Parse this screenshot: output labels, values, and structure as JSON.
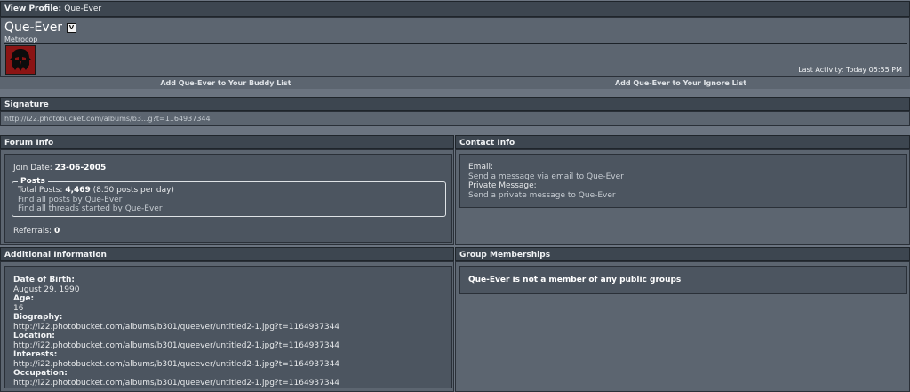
{
  "header": {
    "prefix": "View Profile:",
    "username": "Que-Ever"
  },
  "profile": {
    "display_name": "Que-Ever",
    "rank_badge": "V",
    "title": "Metrocop",
    "last_activity_label": "Last Activity:",
    "last_activity_value": "Today 05:55 PM"
  },
  "actions": {
    "buddy": "Add Que-Ever to Your Buddy List",
    "ignore": "Add Que-Ever to Your Ignore List"
  },
  "signature": {
    "heading": "Signature",
    "text": "http://i22.photobucket.com/albums/b3...g?t=1164937344"
  },
  "forum_info": {
    "heading": "Forum Info",
    "join_label": "Join Date:",
    "join_value": "23-06-2005",
    "posts_legend": "Posts",
    "total_label": "Total Posts:",
    "total_value": "4,469",
    "per_day": "(8.50 posts per day)",
    "find_posts": "Find all posts by Que-Ever",
    "find_threads": "Find all threads started by Que-Ever",
    "referrals_label": "Referrals:",
    "referrals_value": "0"
  },
  "contact_info": {
    "heading": "Contact Info",
    "email_label": "Email:",
    "email_link": "Send a message via email to Que-Ever",
    "pm_label": "Private Message:",
    "pm_link": "Send a private message to Que-Ever"
  },
  "additional": {
    "heading": "Additional Information",
    "fields": [
      {
        "label": "Date of Birth:",
        "value": "August 29, 1990"
      },
      {
        "label": "Age:",
        "value": "16"
      },
      {
        "label": "Biography:",
        "value": "http://i22.photobucket.com/albums/b301/queever/untitled2-1.jpg?t=1164937344"
      },
      {
        "label": "Location:",
        "value": "http://i22.photobucket.com/albums/b301/queever/untitled2-1.jpg?t=1164937344"
      },
      {
        "label": "Interests:",
        "value": "http://i22.photobucket.com/albums/b301/queever/untitled2-1.jpg?t=1164937344"
      },
      {
        "label": "Occupation:",
        "value": "http://i22.photobucket.com/albums/b301/queever/untitled2-1.jpg?t=1164937344"
      }
    ]
  },
  "groups": {
    "heading": "Group Memberships",
    "message": "Que-Ever is not a member of any public groups"
  },
  "colors": {
    "header_bar": "#3d4650",
    "panel": "#5c6570",
    "inset": "#4c5560",
    "page_bg": "#6b7480",
    "avatar": "#8b1414"
  },
  "icons": {
    "avatar": "mandalorian-skull-avatar-icon"
  }
}
